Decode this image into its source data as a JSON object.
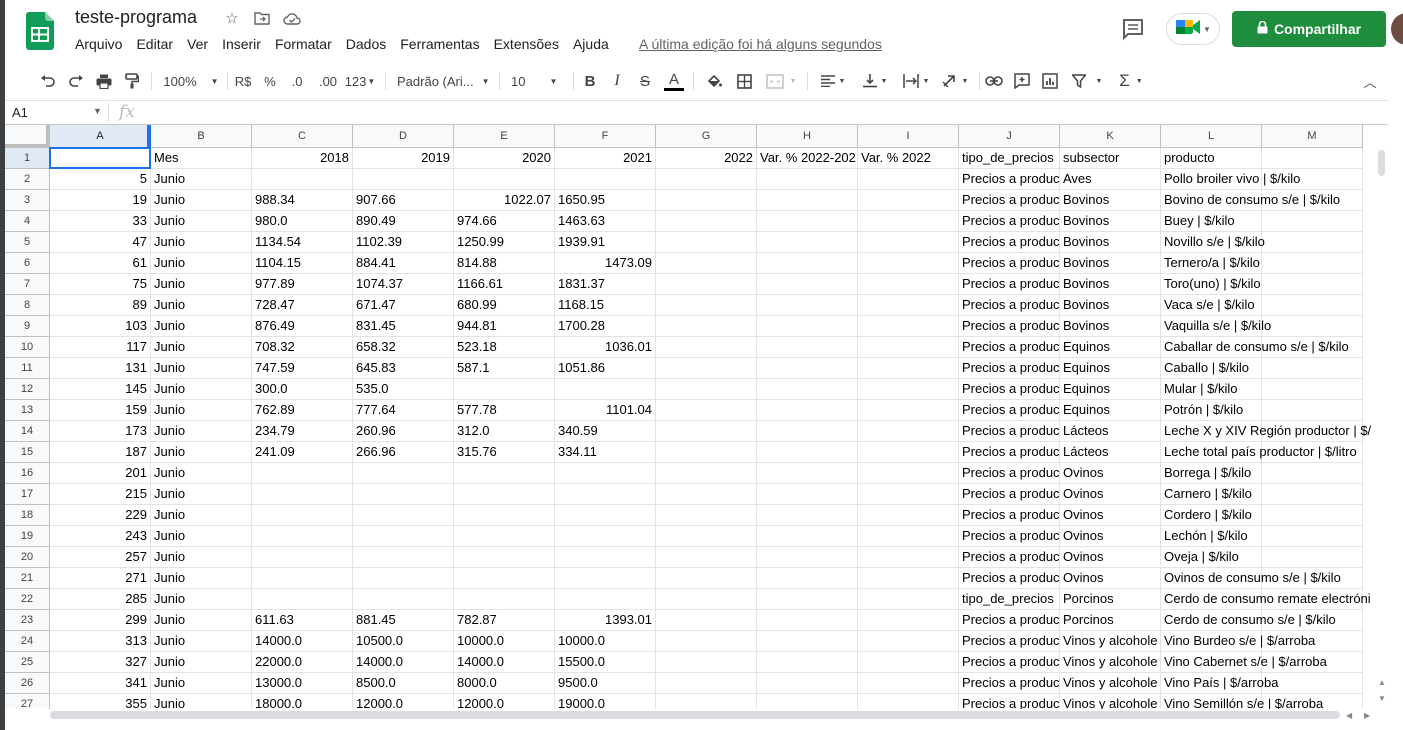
{
  "app": {
    "title": "teste-programa",
    "menu": [
      "Arquivo",
      "Editar",
      "Ver",
      "Inserir",
      "Formatar",
      "Dados",
      "Ferramentas",
      "Extensões",
      "Ajuda"
    ],
    "last_edit": "A última edição foi há alguns segundos",
    "share_label": "Compartilhar"
  },
  "toolbar": {
    "zoom": "100%",
    "currency": "R$",
    "percent": "%",
    "decrease_decimals": ".0",
    "increase_decimals": ".00",
    "number_format": "123",
    "font": "Padrão (Ari...",
    "font_size": "10",
    "bold": "B",
    "italic": "I",
    "strike": "S",
    "text_color": "A",
    "text_color_value": "#000000"
  },
  "formula_bar": {
    "name_box": "A1",
    "fx": "fx",
    "value": ""
  },
  "columns": [
    "A",
    "B",
    "C",
    "D",
    "E",
    "F",
    "G",
    "H",
    "I",
    "J",
    "K",
    "L",
    "M"
  ],
  "selected_cell": "A1",
  "rows": [
    {
      "n": "1",
      "A": "",
      "B": "Mes",
      "C": "2018",
      "D": "2019",
      "E": "2020",
      "F": "2021",
      "G": "2022",
      "H": "Var. % 2022-202",
      "I": "Var. % 2022",
      "J": "tipo_de_precios",
      "K": "subsector",
      "L": "producto"
    },
    {
      "n": "2",
      "A": "5",
      "B": "Junio",
      "C": "",
      "D": "",
      "E": "",
      "F": "",
      "J": "Precios a produc",
      "K": "Aves",
      "L": "Pollo broiler vivo | $/kilo"
    },
    {
      "n": "3",
      "A": "19",
      "B": "Junio",
      "C": "988.34",
      "D": "907.66",
      "E": "1022.07",
      "F": "1650.95",
      "J": "Precios a produc",
      "K": "Bovinos",
      "L": "Bovino de consumo s/e | $/kilo"
    },
    {
      "n": "4",
      "A": "33",
      "B": "Junio",
      "C": "980.0",
      "D": "890.49",
      "E": "974.66",
      "F": "1463.63",
      "J": "Precios a produc",
      "K": "Bovinos",
      "L": "Buey | $/kilo"
    },
    {
      "n": "5",
      "A": "47",
      "B": "Junio",
      "C": "1134.54",
      "D": "1102.39",
      "E": "1250.99",
      "F": "1939.91",
      "J": "Precios a produc",
      "K": "Bovinos",
      "L": "Novillo s/e | $/kilo"
    },
    {
      "n": "6",
      "A": "61",
      "B": "Junio",
      "C": "1104.15",
      "D": "884.41",
      "E": "814.88",
      "F": "1473.09",
      "J": "Precios a produc",
      "K": "Bovinos",
      "L": "Ternero/a | $/kilo"
    },
    {
      "n": "7",
      "A": "75",
      "B": "Junio",
      "C": "977.89",
      "D": "1074.37",
      "E": "1166.61",
      "F": "1831.37",
      "J": "Precios a produc",
      "K": "Bovinos",
      "L": "Toro(uno) | $/kilo"
    },
    {
      "n": "8",
      "A": "89",
      "B": "Junio",
      "C": "728.47",
      "D": "671.47",
      "E": "680.99",
      "F": "1168.15",
      "J": "Precios a produc",
      "K": "Bovinos",
      "L": "Vaca s/e | $/kilo"
    },
    {
      "n": "9",
      "A": "103",
      "B": "Junio",
      "C": "876.49",
      "D": "831.45",
      "E": "944.81",
      "F": "1700.28",
      "J": "Precios a produc",
      "K": "Bovinos",
      "L": "Vaquilla s/e | $/kilo"
    },
    {
      "n": "10",
      "A": "117",
      "B": "Junio",
      "C": "708.32",
      "D": "658.32",
      "E": "523.18",
      "F": "1036.01",
      "J": "Precios a produc",
      "K": "Equinos",
      "L": "Caballar de consumo s/e | $/kilo"
    },
    {
      "n": "11",
      "A": "131",
      "B": "Junio",
      "C": "747.59",
      "D": "645.83",
      "E": "587.1",
      "F": "1051.86",
      "J": "Precios a produc",
      "K": "Equinos",
      "L": "Caballo | $/kilo"
    },
    {
      "n": "12",
      "A": "145",
      "B": "Junio",
      "C": "300.0",
      "D": "535.0",
      "E": "",
      "F": "",
      "J": "Precios a produc",
      "K": "Equinos",
      "L": "Mular | $/kilo"
    },
    {
      "n": "13",
      "A": "159",
      "B": "Junio",
      "C": "762.89",
      "D": "777.64",
      "E": "577.78",
      "F": "1101.04",
      "J": "Precios a produc",
      "K": "Equinos",
      "L": "Potrón | $/kilo"
    },
    {
      "n": "14",
      "A": "173",
      "B": "Junio",
      "C": "234.79",
      "D": "260.96",
      "E": "312.0",
      "F": "340.59",
      "J": "Precios a produc",
      "K": "Lácteos",
      "L": "Leche X y XIV Región productor | $/"
    },
    {
      "n": "15",
      "A": "187",
      "B": "Junio",
      "C": "241.09",
      "D": "266.96",
      "E": "315.76",
      "F": "334.11",
      "J": "Precios a produc",
      "K": "Lácteos",
      "L": "Leche total país productor | $/litro"
    },
    {
      "n": "16",
      "A": "201",
      "B": "Junio",
      "C": "",
      "D": "",
      "E": "",
      "F": "",
      "J": "Precios a produc",
      "K": "Ovinos",
      "L": "Borrega | $/kilo"
    },
    {
      "n": "17",
      "A": "215",
      "B": "Junio",
      "C": "",
      "D": "",
      "E": "",
      "F": "",
      "J": "Precios a produc",
      "K": "Ovinos",
      "L": "Carnero | $/kilo"
    },
    {
      "n": "18",
      "A": "229",
      "B": "Junio",
      "C": "",
      "D": "",
      "E": "",
      "F": "",
      "J": "Precios a produc",
      "K": "Ovinos",
      "L": "Cordero | $/kilo"
    },
    {
      "n": "19",
      "A": "243",
      "B": "Junio",
      "C": "",
      "D": "",
      "E": "",
      "F": "",
      "J": "Precios a produc",
      "K": "Ovinos",
      "L": "Lechón | $/kilo"
    },
    {
      "n": "20",
      "A": "257",
      "B": "Junio",
      "C": "",
      "D": "",
      "E": "",
      "F": "",
      "J": "Precios a produc",
      "K": "Ovinos",
      "L": "Oveja | $/kilo"
    },
    {
      "n": "21",
      "A": "271",
      "B": "Junio",
      "C": "",
      "D": "",
      "E": "",
      "F": "",
      "J": "Precios a produc",
      "K": "Ovinos",
      "L": "Ovinos de consumo s/e | $/kilo"
    },
    {
      "n": "22",
      "A": "285",
      "B": "Junio",
      "C": "",
      "D": "",
      "E": "",
      "F": "",
      "J": "tipo_de_precios",
      "K": "Porcinos",
      "L": "Cerdo de consumo remate electróni"
    },
    {
      "n": "23",
      "A": "299",
      "B": "Junio",
      "C": "611.63",
      "D": "881.45",
      "E": "782.87",
      "F": "1393.01",
      "J": "Precios a produc",
      "K": "Porcinos",
      "L": "Cerdo de consumo s/e | $/kilo"
    },
    {
      "n": "24",
      "A": "313",
      "B": "Junio",
      "C": "14000.0",
      "D": "10500.0",
      "E": "10000.0",
      "F": "10000.0",
      "J": "Precios a produc",
      "K": "Vinos y alcohole",
      "L": "Vino Burdeo s/e | $/arroba"
    },
    {
      "n": "25",
      "A": "327",
      "B": "Junio",
      "C": "22000.0",
      "D": "14000.0",
      "E": "14000.0",
      "F": "15500.0",
      "J": "Precios a produc",
      "K": "Vinos y alcohole",
      "L": "Vino Cabernet s/e | $/arroba"
    },
    {
      "n": "26",
      "A": "341",
      "B": "Junio",
      "C": "13000.0",
      "D": "8500.0",
      "E": "8000.0",
      "F": "9500.0",
      "J": "Precios a produc",
      "K": "Vinos y alcohole",
      "L": "Vino País | $/arroba"
    },
    {
      "n": "27",
      "A": "355",
      "B": "Junio",
      "C": "18000.0",
      "D": "12000.0",
      "E": "12000.0",
      "F": "19000.0",
      "J": "Precios a produc",
      "K": "Vinos y alcohole",
      "L": "Vino Semillón s/e | $/arroba"
    }
  ],
  "right_aligned": {
    "1": [
      "C",
      "D",
      "E",
      "F",
      "G"
    ],
    "3": [
      "E"
    ],
    "6": [
      "F"
    ],
    "10": [
      "F"
    ],
    "13": [
      "F"
    ],
    "23": [
      "F"
    ]
  },
  "colors": {
    "share_green": "#1e8e3e",
    "selection_blue": "#1a73e8",
    "sheets_green": "#0f9d58"
  }
}
